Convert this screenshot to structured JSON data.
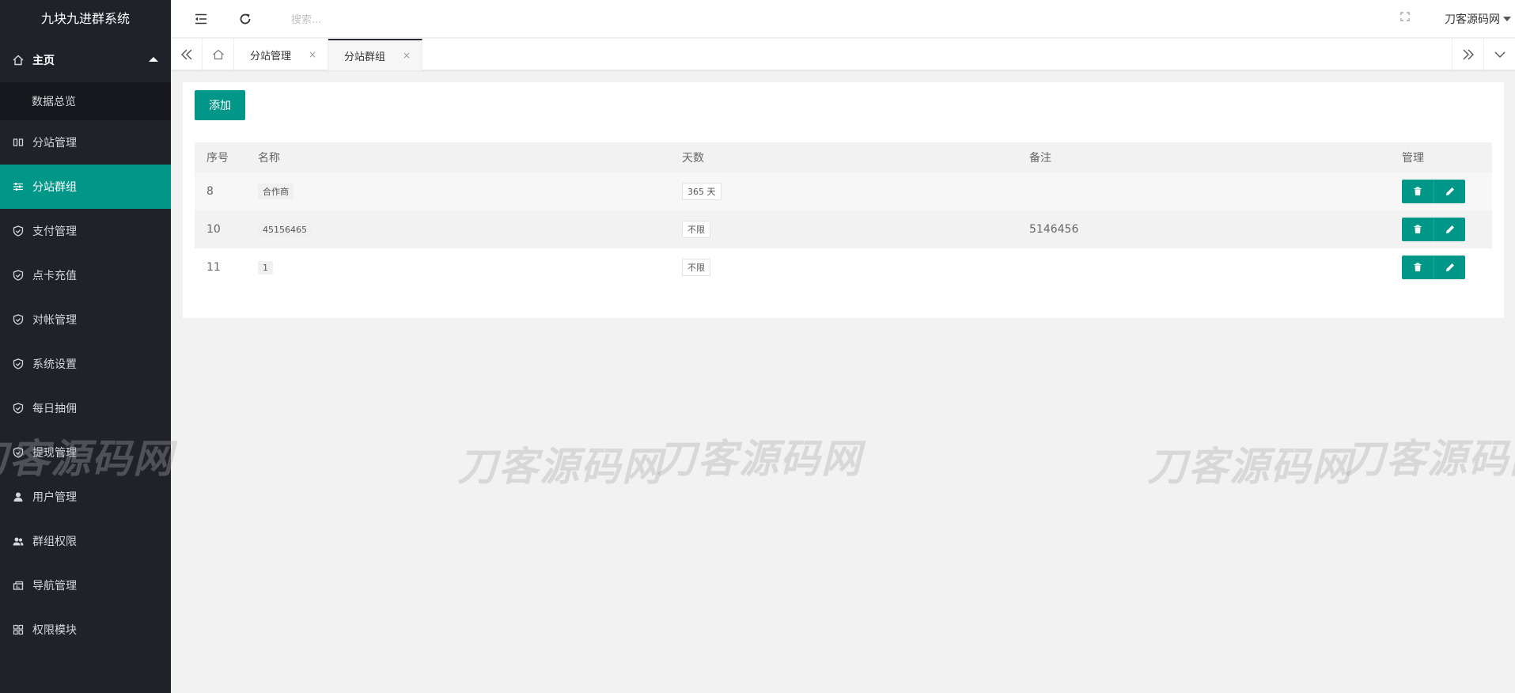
{
  "app": {
    "title": "九块九进群系统"
  },
  "header": {
    "search_placeholder": "搜索...",
    "user_name": "刀客源码网",
    "icons": {
      "flexible": "menu-fold-icon",
      "refresh": "refresh-icon",
      "fullscreen": "fullscreen-icon"
    }
  },
  "sidebar": {
    "home": {
      "label": "主页",
      "icon": "home-icon"
    },
    "home_sub": {
      "label": "数据总览"
    },
    "items": [
      {
        "label": "分站管理",
        "icon": "columns-icon"
      },
      {
        "label": "分站群组",
        "icon": "sliders-icon",
        "active": true
      },
      {
        "label": "支付管理",
        "icon": "shield-icon"
      },
      {
        "label": "点卡充值",
        "icon": "shield-icon"
      },
      {
        "label": "对帐管理",
        "icon": "shield-icon"
      },
      {
        "label": "系统设置",
        "icon": "shield-icon"
      },
      {
        "label": "每日抽佣",
        "icon": "shield-icon"
      },
      {
        "label": "提现管理",
        "icon": "shield-icon"
      },
      {
        "label": "用户管理",
        "icon": "user-icon"
      },
      {
        "label": "群组权限",
        "icon": "users-icon"
      },
      {
        "label": "导航管理",
        "icon": "nav-icon"
      },
      {
        "label": "权限模块",
        "icon": "grid-icon"
      }
    ]
  },
  "tabs": {
    "items": [
      {
        "label": "分站管理",
        "active": false
      },
      {
        "label": "分站群组",
        "active": true
      }
    ],
    "close_glyph": "×"
  },
  "toolbar": {
    "add_label": "添加"
  },
  "table": {
    "columns": [
      "序号",
      "名称",
      "天数",
      "备注",
      "管理"
    ],
    "rows": [
      {
        "id": "8",
        "name": "合作商",
        "days": "365 天",
        "note": ""
      },
      {
        "id": "10",
        "name": "45156465",
        "days": "不限",
        "note": "5146456"
      },
      {
        "id": "11",
        "name": "1",
        "days": "不限",
        "note": ""
      }
    ]
  },
  "watermark": {
    "text": "刀客源码网"
  },
  "colors": {
    "accent": "#009688",
    "sidebar_bg": "#20222a",
    "sidebar_sub_bg": "#17181d"
  }
}
